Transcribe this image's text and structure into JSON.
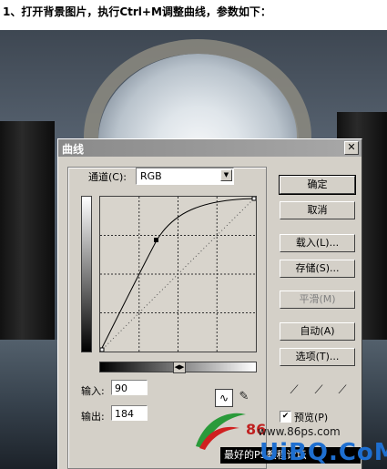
{
  "instruction": "1、打开背景图片，执行Ctrl+M调整曲线，参数如下：",
  "dialog": {
    "title": "曲线",
    "close_glyph": "✕",
    "channel_label": "通道(C):",
    "channel_value": "RGB",
    "input_label": "输入:",
    "input_value": "90",
    "output_label": "输出:",
    "output_value": "184",
    "buttons": {
      "ok": "确定",
      "cancel": "取消",
      "load": "载入(L)...",
      "save": "存储(S)...",
      "smooth": "平滑(M)",
      "auto": "自动(A)",
      "options": "选项(T)..."
    },
    "preview_label": "预览(P)",
    "preview_checked": true,
    "status_text": "最好的PS教程论坛"
  },
  "watermark": {
    "number": "86",
    "site": "www.86ps.com",
    "brand": "UiBQ.CoM"
  },
  "icons": {
    "dropdown": "chevron-down-icon",
    "close": "close-icon",
    "curve_tool": "curve-icon",
    "pencil": "pencil-icon",
    "eyedroppers": [
      "eyedropper-black-icon",
      "eyedropper-gray-icon",
      "eyedropper-white-icon"
    ],
    "checkmark": "check-icon"
  }
}
